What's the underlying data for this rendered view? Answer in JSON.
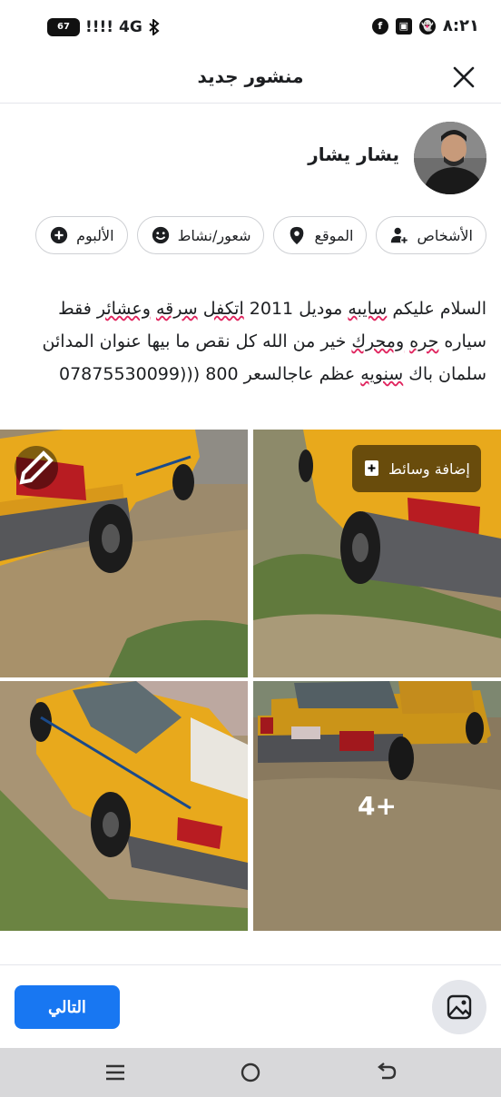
{
  "status_bar": {
    "time": "٨:٢١",
    "network": "4G",
    "signal": "!!!!",
    "battery": "67",
    "icons": [
      "facebook-icon",
      "app-icon",
      "snapchat-icon",
      "bluetooth-icon"
    ]
  },
  "header": {
    "title": "منشور جديد",
    "close_icon": "close-icon"
  },
  "user": {
    "name": "يشار يشار"
  },
  "chips": [
    {
      "label": "الأشخاص",
      "icon": "people-icon"
    },
    {
      "label": "الموقع",
      "icon": "location-icon"
    },
    {
      "label": "شعور/نشاط",
      "icon": "smiley-icon"
    },
    {
      "label": "الألبوم",
      "icon": "plus-circle-icon"
    }
  ],
  "post": {
    "p1": "السلام عليكم ",
    "w1": "سايبه",
    "p2": " موديل 2011 ",
    "w2": "اتكفل",
    "p3": " ",
    "w3": "سرقه",
    "p4": " ",
    "w4": "وعشائر",
    "p5": " فقط سياره ",
    "w5": "حره",
    "p6": " ",
    "w6": "ومحرك",
    "p7": " خير من الله كل نقص ما بيها عنوان المدائن سلمان باك ",
    "w7": "سنويه",
    "p8": " عظم عاجالسعر 800 (((07875530099"
  },
  "media": {
    "add_media_label": "إضافة وسائط",
    "more_count": "4+"
  },
  "footer": {
    "next_label": "التالي"
  },
  "colors": {
    "accent": "#1877f2",
    "taxi_yellow": "#e8a91c",
    "underline_red": "#e0245e"
  }
}
